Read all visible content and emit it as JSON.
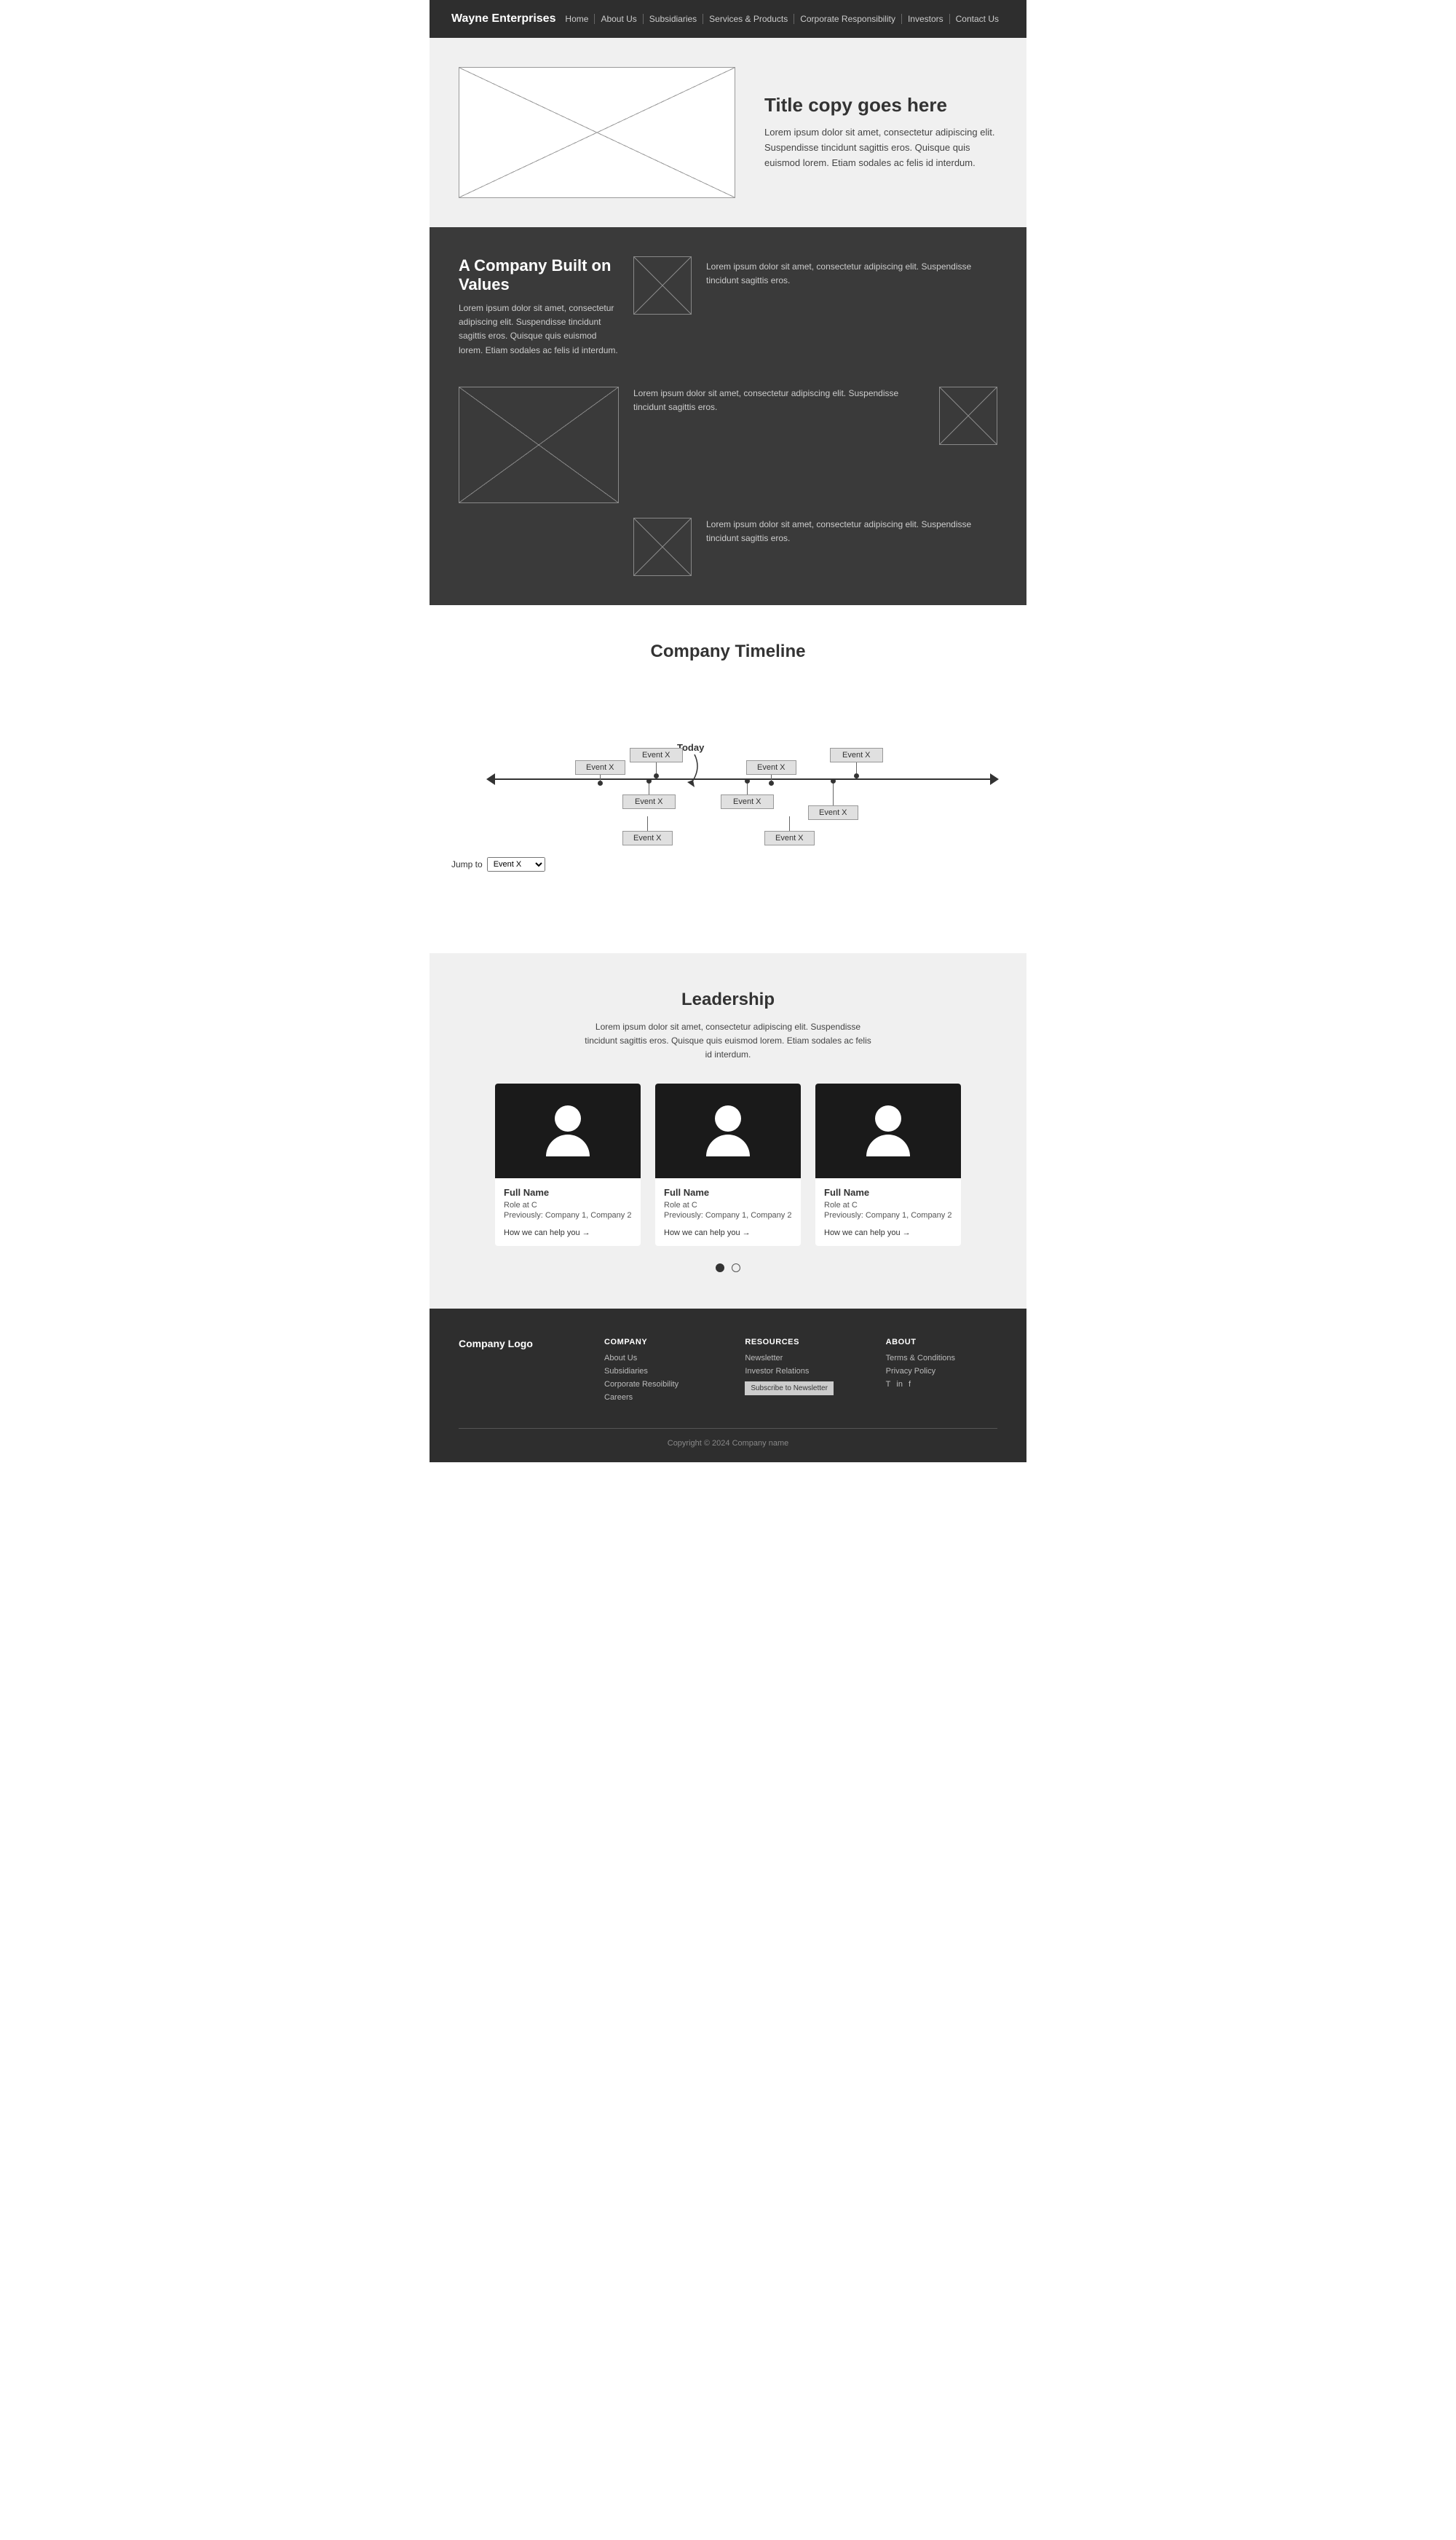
{
  "nav": {
    "logo": "Wayne Enterprises",
    "links": [
      {
        "label": "Home",
        "id": "home"
      },
      {
        "label": "About Us",
        "id": "about"
      },
      {
        "label": "Subsidiaries",
        "id": "subsidiaries"
      },
      {
        "label": "Services & Products",
        "id": "services"
      },
      {
        "label": "Corporate Responsibility",
        "id": "corporate"
      },
      {
        "label": "Investors",
        "id": "investors"
      },
      {
        "label": "Contact Us",
        "id": "contact"
      }
    ]
  },
  "hero": {
    "title": "Title copy goes here",
    "body": "Lorem ipsum dolor sit amet, consectetur adipiscing elit. Suspendisse tincidunt sagittis eros. Quisque quis euismod lorem. Etiam sodales ac felis id interdum."
  },
  "dark_section": {
    "heading": "A Company Built on Values",
    "subtitle": "Lorem ipsum dolor sit amet, consectetur adipiscing elit. Suspendisse tincidunt sagittis eros. Quisque quis euismod lorem. Etiam sodales ac felis id interdum.",
    "text1": "Lorem ipsum dolor sit amet, consectetur adipiscing elit. Suspendisse tincidunt sagittis eros.",
    "text2": "Lorem ipsum dolor sit amet, consectetur adipiscing elit. Suspendisse tincidunt sagittis eros.",
    "text3": "Lorem ipsum dolor sit amet, consectetur adipiscing elit. Suspendisse tincidunt sagittis eros."
  },
  "timeline": {
    "heading": "Company Timeline",
    "today_label": "Today",
    "jump_label": "Jump to",
    "events": [
      {
        "label": "Event X",
        "col": 40,
        "row": "top"
      },
      {
        "label": "Event X",
        "col": 28,
        "row": "mid-up"
      },
      {
        "label": "Event X",
        "col": 53,
        "row": "mid-up"
      },
      {
        "label": "Event X",
        "col": 38,
        "row": "mid-down"
      },
      {
        "label": "Event X",
        "col": 59,
        "row": "mid-down"
      },
      {
        "label": "Event X",
        "col": 70,
        "row": "top"
      },
      {
        "label": "Event X",
        "col": 46,
        "row": "bot"
      },
      {
        "label": "Event X",
        "col": 63,
        "row": "bot"
      }
    ],
    "dropdown_options": [
      "Event X",
      "Event X",
      "Event X",
      "Event X",
      "Event X",
      "Event X",
      "Event X",
      "Event X",
      "Event X"
    ]
  },
  "leadership": {
    "heading": "Leadership",
    "description": "Lorem ipsum dolor sit amet, consectetur adipiscing elit. Suspendisse tincidunt sagittis eros. Quisque quis euismod lorem. Etiam sodales ac felis id interdum.",
    "leaders": [
      {
        "name": "Full Name",
        "role": "Role at C",
        "previously": "Previously: Company 1, Company 2",
        "link": "How we can help you →"
      },
      {
        "name": "Full Name",
        "role": "Role at C",
        "previously": "Previously: Company 1, Company 2",
        "link": "How we can help you →"
      },
      {
        "name": "Full Name",
        "role": "Role at C",
        "previously": "Previously: Company 1, Company 2",
        "link": "How we can help you →"
      }
    ]
  },
  "footer": {
    "logo": "Company Logo",
    "company_col": {
      "title": "COMPANY",
      "links": [
        "About Us",
        "Subsidiaries",
        "Corporate Resoibility",
        "Careers"
      ]
    },
    "resources_col": {
      "title": "RESOURCES",
      "links": [
        "Newsletter",
        "Investor Relations"
      ],
      "cta": "Subscribe to Newsletter"
    },
    "about_col": {
      "title": "ABOUT",
      "links": [
        "Terms & Conditions",
        "Privacy Policy"
      ],
      "socials": [
        "T",
        "in",
        "f"
      ]
    },
    "copyright": "Copyright © 2024 Company name"
  }
}
